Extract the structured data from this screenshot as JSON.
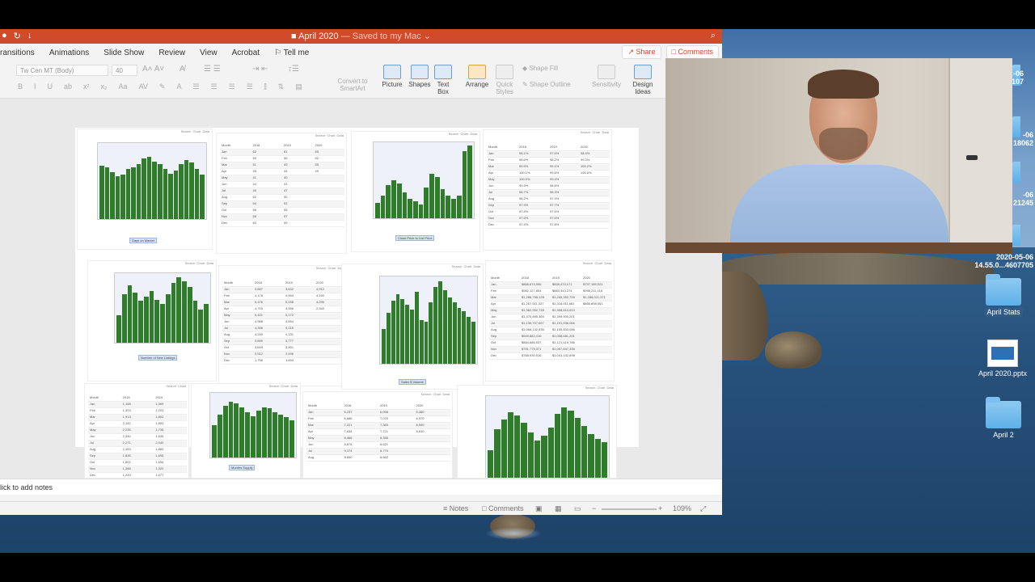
{
  "window": {
    "title": "April 2020",
    "subtitle": " — Saved to my Mac ⌄"
  },
  "tabs": [
    "ransitions",
    "Animations",
    "Slide Show",
    "Review",
    "View",
    "Acrobat",
    "Tell me"
  ],
  "share_label": "Share",
  "comments_label": "Comments",
  "ribbon": {
    "font": "Tw Cen MT (Body)",
    "size": "40",
    "convert_label": "Convert to SmartArt",
    "picture": "Picture",
    "shapes": "Shapes",
    "textbox": "Text Box",
    "arrange": "Arrange",
    "quick_styles": "Quick Styles",
    "shape_fill": "Shape Fill",
    "shape_outline": "Shape Outline",
    "sensitivity": "Sensitivity",
    "design_ideas": "Design Ideas"
  },
  "notes_placeholder": "lick to add notes",
  "status": {
    "notes": "Notes",
    "comments": "Comments",
    "zoom": "109%"
  },
  "desktop": {
    "frag1": "-06",
    "frag1b": "05107",
    "frag2": "-06",
    "frag2b": "18062",
    "frag3": "-06",
    "frag3b": "21245",
    "file_name": "2020-05-06",
    "file_name2": "14.55.0...4607705",
    "april_stats": "April Stats",
    "april_pptx": "April 2020.pptx",
    "april2": "April 2"
  },
  "accent_color": "#d14a2a",
  "bar_color": "#2f7d2a"
}
